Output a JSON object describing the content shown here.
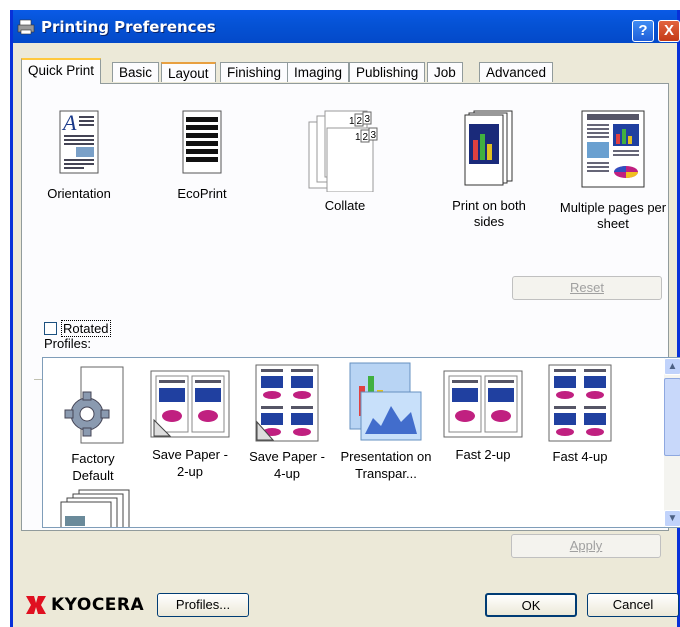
{
  "window": {
    "title": "Printing Preferences",
    "help": "?",
    "close": "X"
  },
  "tabs": [
    "Quick Print",
    "Basic",
    "Layout",
    "Finishing",
    "Imaging",
    "Publishing",
    "Job",
    "Advanced"
  ],
  "quick_print": [
    {
      "label": "Orientation",
      "icon": "orientation-icon"
    },
    {
      "label": "EcoPrint",
      "icon": "ecoprint-icon"
    },
    {
      "label": "Collate",
      "icon": "collate-icon"
    },
    {
      "label": "Print on both sides",
      "icon": "duplex-icon"
    },
    {
      "label": "Multiple pages per sheet",
      "icon": "multiple-pages-icon"
    }
  ],
  "rotated": {
    "label": "Rotated",
    "checked": false
  },
  "reset_label": "Reset",
  "profiles_label": "Profiles:",
  "profiles": [
    {
      "label": "Factory Default",
      "icon": "factory-default-icon"
    },
    {
      "label": "Save Paper - 2-up",
      "icon": "save-paper-2up-icon"
    },
    {
      "label": "Save Paper - 4-up",
      "icon": "save-paper-4up-icon"
    },
    {
      "label": "Presentation on Transpar...",
      "icon": "presentation-icon"
    },
    {
      "label": "Fast 2-up",
      "icon": "fast-2up-icon"
    },
    {
      "label": "Fast 4-up",
      "icon": "fast-4up-icon"
    }
  ],
  "apply_label": "Apply",
  "footer": {
    "brand": "KYOCERA",
    "profiles_button": "Profiles...",
    "ok": "OK",
    "cancel": "Cancel"
  }
}
